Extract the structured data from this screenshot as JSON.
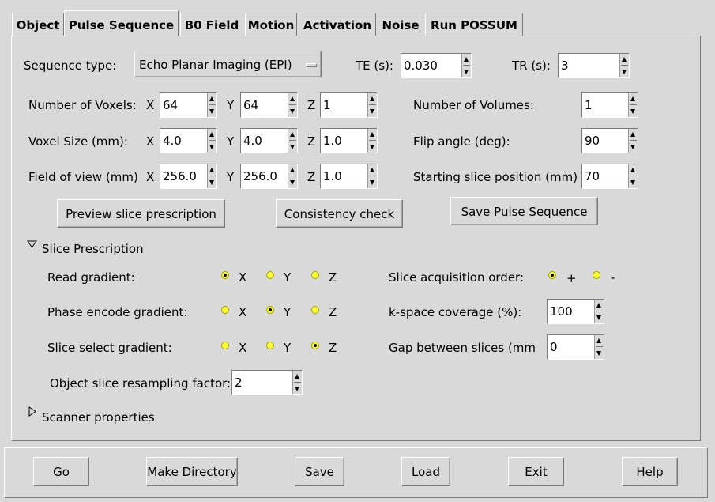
{
  "tabs": [
    "Object",
    "Pulse Sequence",
    "B0 Field",
    "Motion",
    "Activation",
    "Noise",
    "Run POSSUM"
  ],
  "sequence": {
    "label": "Sequence type:",
    "value": "Echo Planar Imaging (EPI)",
    "te_label": "TE (s):",
    "te_value": "0.030",
    "tr_label": "TR (s):",
    "tr_value": "3"
  },
  "voxels": {
    "label": "Number of Voxels:",
    "x_label": "X",
    "x": "64",
    "y_label": "Y",
    "y": "64",
    "z_label": "Z",
    "z": "1"
  },
  "voxel_size": {
    "label": "Voxel Size (mm):",
    "x_label": "X",
    "x": "4.0",
    "y_label": "Y",
    "y": "4.0",
    "z_label": "Z",
    "z": "1.0"
  },
  "fov": {
    "label": "Field of view (mm)",
    "x_label": "X",
    "x": "256.0",
    "y_label": "Y",
    "y": "256.0",
    "z_label": "Z",
    "z": "1.0"
  },
  "volumes": {
    "label": "Number of Volumes:",
    "value": "1"
  },
  "flip": {
    "label": "Flip angle (deg):",
    "value": "90"
  },
  "start_slice": {
    "label": "Starting slice position (mm)",
    "value": "70"
  },
  "buttons": {
    "preview": "Preview slice prescription",
    "consistency": "Consistency check",
    "save_seq": "Save Pulse Sequence"
  },
  "slice_prescription": {
    "title": "Slice Prescription",
    "read": {
      "label": "Read gradient:",
      "options": [
        "X",
        "Y",
        "Z"
      ]
    },
    "phase": {
      "label": "Phase encode gradient:",
      "options": [
        "X",
        "Y",
        "Z"
      ]
    },
    "select": {
      "label": "Slice select gradient:",
      "options": [
        "X",
        "Y",
        "Z"
      ]
    },
    "order": {
      "label": "Slice acquisition order:",
      "plus": "+",
      "minus": "-"
    },
    "kspace": {
      "label": "k-space coverage (%):",
      "value": "100"
    },
    "gap": {
      "label": "Gap between slices (mm",
      "value": "0"
    },
    "resample": {
      "label": "Object slice resampling factor:",
      "value": "2"
    }
  },
  "scanner": {
    "title": "Scanner properties"
  },
  "bottom_buttons": {
    "go": "Go",
    "make_dir": "Make Directory",
    "save": "Save",
    "load": "Load",
    "exit": "Exit",
    "help": "Help"
  }
}
